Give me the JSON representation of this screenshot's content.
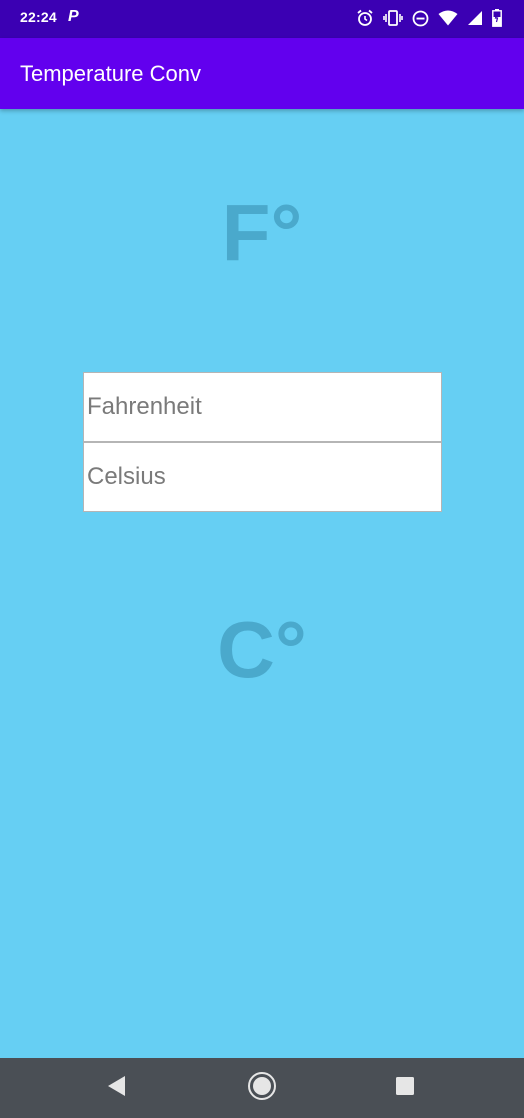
{
  "status_bar": {
    "time": "22:24",
    "notification_icon": "P",
    "icons": [
      "alarm-icon",
      "vibrate-icon",
      "do-not-disturb-icon",
      "wifi-icon",
      "signal-icon",
      "battery-icon"
    ]
  },
  "app_bar": {
    "title": "Temperature Conv"
  },
  "fahrenheit": {
    "unit_label": "F°",
    "placeholder": "Fahrenheit",
    "value": ""
  },
  "celsius": {
    "unit_label": "C°",
    "placeholder": "Celsius",
    "value": ""
  },
  "nav_bar": {
    "icons": [
      "back-icon",
      "home-icon",
      "recents-icon"
    ]
  },
  "colors": {
    "background": "#66cff3",
    "app_bar": "#6200ee",
    "status_bar": "#3b00b3",
    "unit_label": "#4aa9cc",
    "nav_bar": "#4a4f55"
  }
}
